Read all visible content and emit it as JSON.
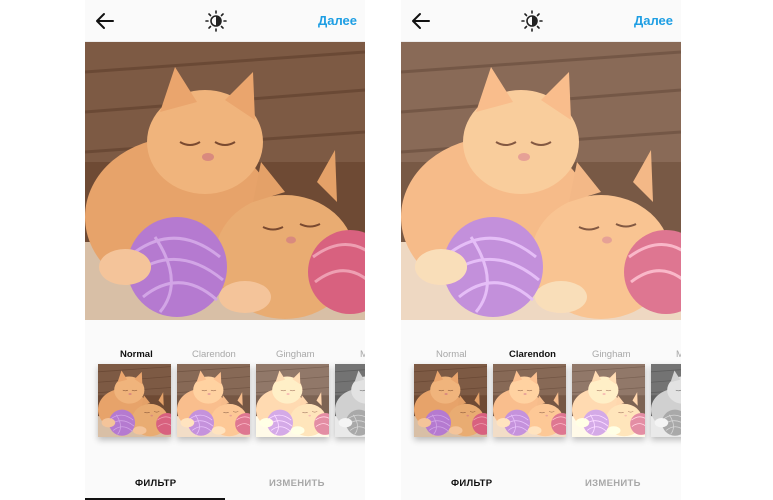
{
  "screens": [
    {
      "header": {
        "next_label": "Далее"
      },
      "filters": [
        {
          "label": "Normal",
          "selected": true
        },
        {
          "label": "Clarendon",
          "selected": false
        },
        {
          "label": "Gingham",
          "selected": false
        },
        {
          "label": "M",
          "selected": false
        }
      ],
      "tabs": [
        {
          "label": "ФИЛЬТР",
          "active": true
        },
        {
          "label": "ИЗМЕНИТЬ",
          "active": false
        }
      ]
    },
    {
      "header": {
        "next_label": "Далее"
      },
      "filters": [
        {
          "label": "Normal",
          "selected": false
        },
        {
          "label": "Clarendon",
          "selected": true
        },
        {
          "label": "Gingham",
          "selected": false
        },
        {
          "label": "M",
          "selected": false
        }
      ],
      "tabs": [
        {
          "label": "ФИЛЬТР",
          "active": true
        },
        {
          "label": "ИЗМЕНИТЬ",
          "active": false
        }
      ]
    }
  ],
  "icons": {
    "back": "arrow-left-icon",
    "adjust": "brightness-icon"
  },
  "colors": {
    "accent": "#1e9ee3",
    "active_text": "#111111",
    "inactive_text": "#a8a8a8"
  }
}
